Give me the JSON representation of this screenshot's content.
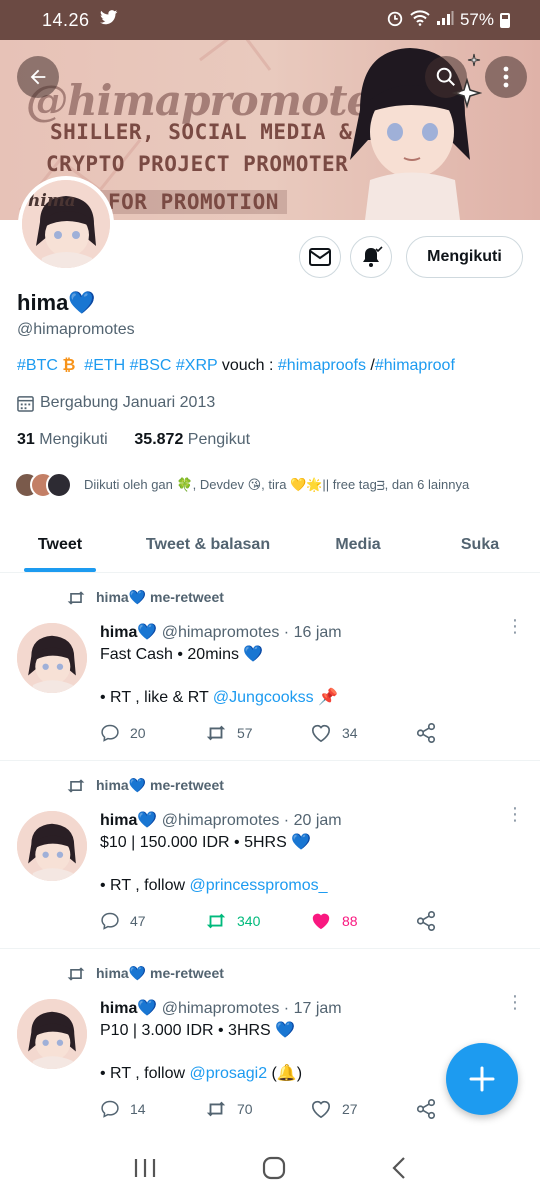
{
  "status": {
    "time": "14.26",
    "battery": "57%"
  },
  "banner": {
    "handle": "@himapromotes",
    "line1": "SHILLER, SOCIAL MEDIA &",
    "line2": "CRYPTO PROJECT PROMOTER",
    "line3": "FOR PROMOTION"
  },
  "profile": {
    "avatar_text": "hima",
    "name": "hima",
    "heart": "💙",
    "handle": "@himapromotes",
    "bio": {
      "btc": "#BTC",
      "btc_emoji": "₿",
      "eth": "#ETH",
      "bsc": "#BSC",
      "xrp": "#XRP",
      "vouch": " vouch : ",
      "proofs": "#himaproofs",
      "slash": " /",
      "proof": "#himaproof"
    },
    "joined": "Bergabung Januari 2013",
    "following_count": "31",
    "following_label": "Mengikuti",
    "followers_count": "35.872",
    "followers_label": "Pengikut",
    "followed_by": "Diikuti oleh gan 🍀, Devdev 😘, tira 💛🌟|| free tagᴟ, dan 6 lainnya",
    "follow_button": "Mengikuti"
  },
  "tabs": [
    "Tweet",
    "Tweet & balasan",
    "Media",
    "Suka"
  ],
  "tweets": [
    {
      "retweeter": "hima💙 me-retweet",
      "name": "hima💙",
      "handle": "@himapromotes",
      "time": "· 16 jam",
      "line1": "Fast Cash • 20mins 💙",
      "line2_pre": "• RT , like & RT ",
      "line2_mention": "@Jungcookss",
      "line2_post": " 📌",
      "replies": "20",
      "retweets": "57",
      "likes": "34"
    },
    {
      "retweeter": "hima💙 me-retweet",
      "name": "hima💙",
      "handle": "@himapromotes",
      "time": "· 20 jam",
      "line1": "$10 | 150.000 IDR • 5HRS 💙",
      "line2_pre": "• RT , follow ",
      "line2_mention": "@princesspromos_",
      "line2_post": "",
      "replies": "47",
      "retweets": "340",
      "likes": "88"
    },
    {
      "retweeter": "hima💙 me-retweet",
      "name": "hima💙",
      "handle": "@himapromotes",
      "time": "· 17 jam",
      "line1": "P10 | 3.000 IDR • 3HRS 💙",
      "line2_pre": "• RT , follow ",
      "line2_mention": "@prosagi2",
      "line2_post": " (🔔)",
      "replies": "14",
      "retweets": "70",
      "likes": "27"
    }
  ],
  "colors": {
    "accent": "#1d9bf0",
    "retweet_active": "#00ba7c",
    "like_active": "#f91880"
  }
}
